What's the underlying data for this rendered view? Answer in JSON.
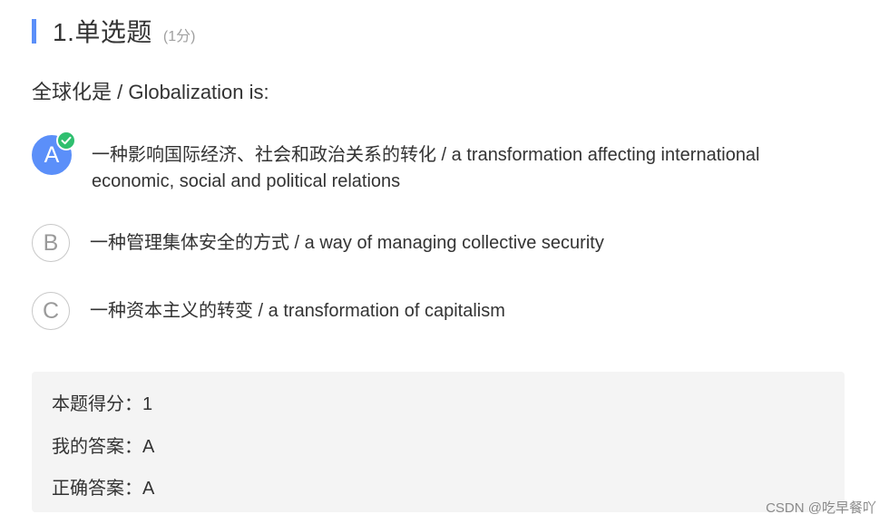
{
  "question": {
    "title": "1.单选题",
    "score": "(1分)",
    "stem": "全球化是 / Globalization is:"
  },
  "options": [
    {
      "letter": "A",
      "line1": "一种影响国际经济、社会和政治关系的转化 / a transformation affecting international",
      "line2": "economic, social and political relations",
      "selected": true,
      "correct": true
    },
    {
      "letter": "B",
      "line1": "一种管理集体安全的方式 / a way of managing collective security",
      "selected": false
    },
    {
      "letter": "C",
      "line1": "一种资本主义的转变 / a transformation of capitalism",
      "selected": false
    }
  ],
  "result": {
    "score_line": "本题得分：1",
    "my_answer_line": "我的答案：A",
    "correct_answer_line": "正确答案：A"
  },
  "watermark": "CSDN @吃早餐吖",
  "colors": {
    "accent": "#5b8ff9",
    "correct_badge": "#2fbf6f",
    "answer_box_bg": "#f4f4f4"
  },
  "icons": {
    "check": "check-icon"
  }
}
